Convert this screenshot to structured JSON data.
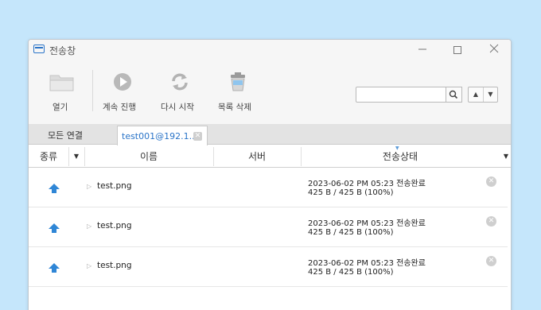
{
  "window": {
    "title": "전송창"
  },
  "toolbar": {
    "open_label": "열기",
    "resume_label": "계속 진행",
    "restart_label": "다시 시작",
    "delete_list_label": "목록 삭제",
    "search_value": ""
  },
  "tabs": [
    {
      "label": "모든 연결"
    },
    {
      "label": "test001@192.1..."
    }
  ],
  "columns": {
    "type": "종류",
    "name": "이름",
    "server": "서버",
    "status": "전송상태"
  },
  "rows": [
    {
      "name": "test.png",
      "status_line1": "2023-06-02 PM 05:23 전송완료",
      "status_line2": "425 B / 425 B (100%)"
    },
    {
      "name": "test.png",
      "status_line1": "2023-06-02 PM 05:23 전송완료",
      "status_line2": "425 B / 425 B (100%)"
    },
    {
      "name": "test.png",
      "status_line1": "2023-06-02 PM 05:23 전송완료",
      "status_line2": "425 B / 425 B (100%)"
    }
  ],
  "colors": {
    "accent": "#2a74c8",
    "upload_arrow": "#2f86d6",
    "background": "#c5e6fb"
  },
  "icons": [
    "folder-icon",
    "play-icon",
    "refresh-icon",
    "trash-icon",
    "search-icon",
    "upload-arrow-icon",
    "close-circle-icon"
  ]
}
